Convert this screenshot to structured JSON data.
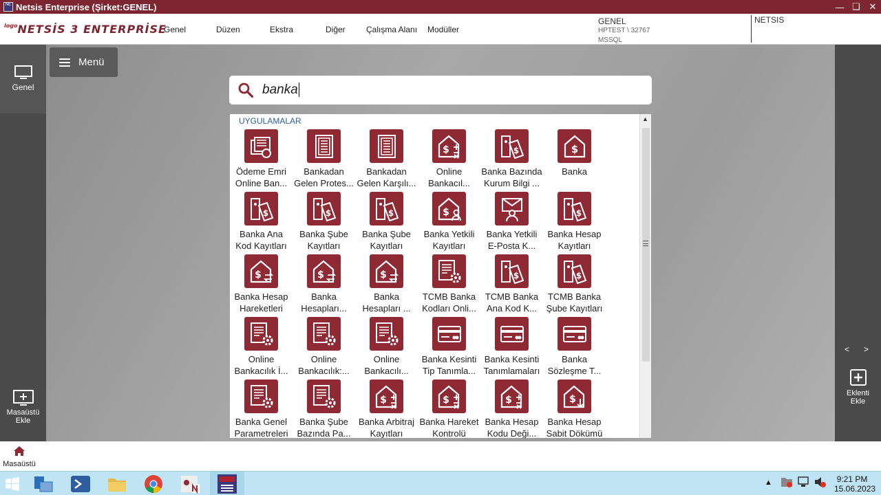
{
  "window": {
    "title": "Netsis Enterprise (Şirket:GENEL)"
  },
  "menubar": {
    "logo_small": "logo",
    "logo": "NETSİS 3 ENTERPRİSE",
    "items": [
      "Genel",
      "Düzen",
      "Ekstra",
      "Diğer",
      "Çalışma Alanı",
      "Modüller"
    ],
    "company": "GENEL",
    "server": "HPTEST \\ 32767",
    "db": "MSSQL",
    "user": "NETSIS"
  },
  "leftbar": {
    "genel": "Genel",
    "desktop_add": "Masaüstü Ekle"
  },
  "menu_button": "Menü",
  "search": {
    "query": "banka"
  },
  "results": {
    "category": "UYGULAMALAR",
    "tiles": [
      {
        "l1": "Ödeme Emri",
        "l2": "Online Ban...",
        "icon": "payment-order-icon"
      },
      {
        "l1": "Bankadan",
        "l2": "Gelen Protes...",
        "icon": "document-list-icon"
      },
      {
        "l1": "Bankadan",
        "l2": "Gelen Karşılı...",
        "icon": "document-list-icon"
      },
      {
        "l1": "Online",
        "l2": "Bankacıl...",
        "icon": "house-dollar-calc-icon"
      },
      {
        "l1": "Banka Bazında",
        "l2": "Kurum Bilgi ...",
        "icon": "binder-dollar-icon"
      },
      {
        "l1": "Banka",
        "l2": "",
        "icon": "house-dollar-icon"
      },
      {
        "l1": "Banka Ana",
        "l2": "Kod Kayıtları",
        "icon": "binder-dollar-icon"
      },
      {
        "l1": "Banka Şube",
        "l2": "Kayıtları",
        "icon": "binder-dollar-icon"
      },
      {
        "l1": "Banka Şube",
        "l2": "Kayıtları",
        "icon": "binder-dollar-icon"
      },
      {
        "l1": "Banka Yetkili",
        "l2": "Kayıtları",
        "icon": "house-dollar-person-icon"
      },
      {
        "l1": "Banka Yetkili",
        "l2": "E-Posta K...",
        "icon": "mail-person-icon"
      },
      {
        "l1": "Banka Hesap",
        "l2": "Kayıtları",
        "icon": "binder-dollar-icon"
      },
      {
        "l1": "Banka Hesap",
        "l2": "Hareketleri",
        "icon": "house-dollar-arrows-icon"
      },
      {
        "l1": "Banka",
        "l2": "Hesapları...",
        "icon": "house-dollar-arrows-icon"
      },
      {
        "l1": "Banka",
        "l2": "Hesapları ...",
        "icon": "house-dollar-arrows-icon"
      },
      {
        "l1": "TCMB Banka",
        "l2": "Kodları Onli...",
        "icon": "document-gear-icon"
      },
      {
        "l1": "TCMB Banka",
        "l2": "Ana Kod K...",
        "icon": "binder-dollar-icon"
      },
      {
        "l1": "TCMB Banka",
        "l2": "Şube Kayıtları",
        "icon": "binder-dollar-icon"
      },
      {
        "l1": "Online",
        "l2": "Bankacılık İ...",
        "icon": "document-gear-icon"
      },
      {
        "l1": "Online",
        "l2": "Bankacılık:...",
        "icon": "document-gear-icon"
      },
      {
        "l1": "Online",
        "l2": "Bankacılı...",
        "icon": "document-gear-icon"
      },
      {
        "l1": "Banka Kesinti",
        "l2": "Tip Tanımla...",
        "icon": "card-icon"
      },
      {
        "l1": "Banka Kesinti",
        "l2": "Tanımlamaları",
        "icon": "card-icon"
      },
      {
        "l1": "Banka",
        "l2": "Sözleşme T...",
        "icon": "card-icon"
      },
      {
        "l1": "Banka Genel",
        "l2": "Parametreleri",
        "icon": "document-gear-icon"
      },
      {
        "l1": "Banka Şube",
        "l2": "Bazında Pa...",
        "icon": "document-gear-icon"
      },
      {
        "l1": "Banka Arbitraj",
        "l2": "Kayıtları",
        "icon": "house-dollar-calc-icon"
      },
      {
        "l1": "Banka Hareket",
        "l2": "Kontrolü",
        "icon": "house-dollar-calc-icon"
      },
      {
        "l1": "Banka Hesap",
        "l2": "Kodu Deği...",
        "icon": "house-dollar-calc-icon"
      },
      {
        "l1": "Banka Hesap",
        "l2": "Sabit Dökümü",
        "icon": "house-dollar-down-icon"
      }
    ]
  },
  "rightbar": {
    "prev": "<",
    "next": ">",
    "add_plugin": "Eklenti Ekle"
  },
  "bottombar": {
    "home": "Masaüstü"
  },
  "taskbar": {
    "time": "9:21 PM",
    "date": "15.06.2023"
  }
}
